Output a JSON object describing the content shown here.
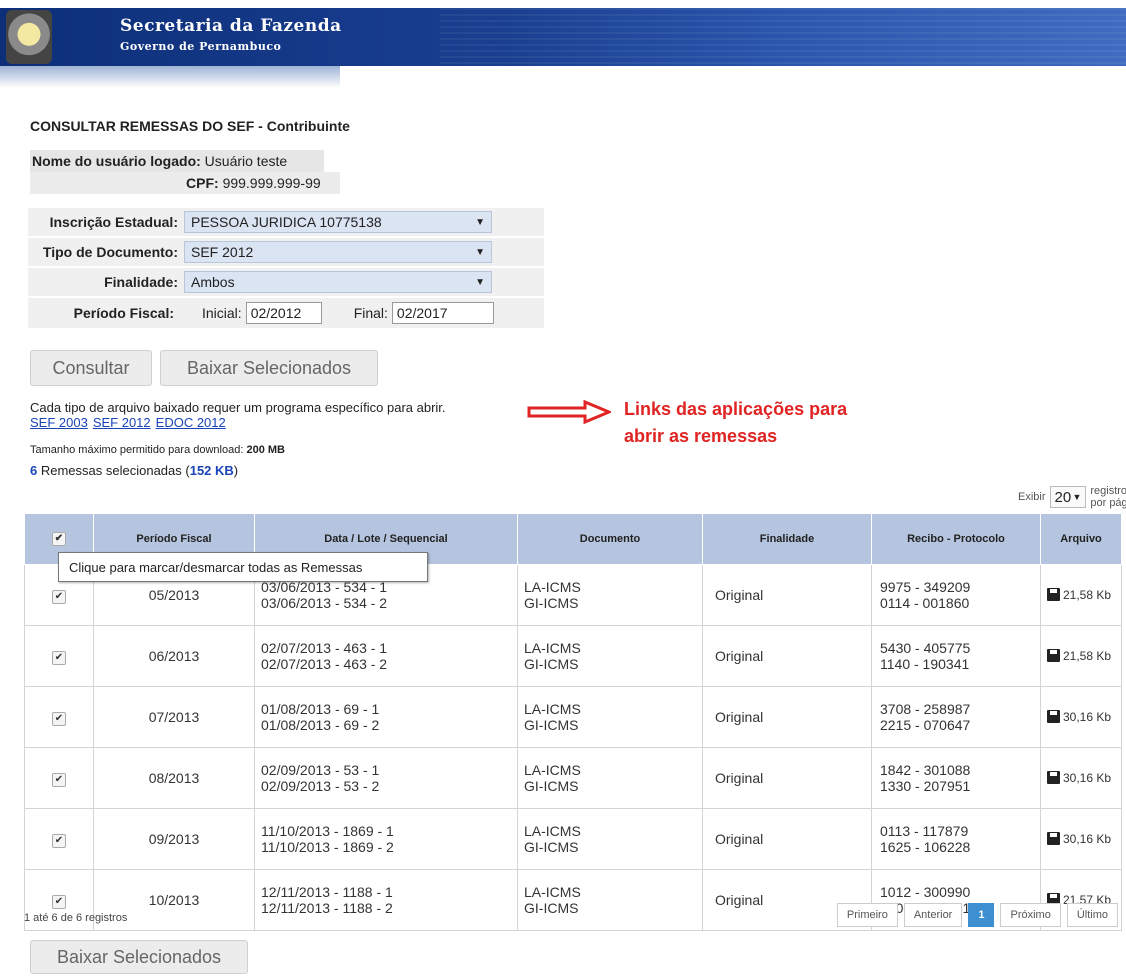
{
  "header": {
    "title": "Secretaria da Fazenda",
    "subtitle": "Governo de Pernambuco"
  },
  "page_title": "CONSULTAR REMESSAS DO SEF - Contribuinte",
  "user": {
    "name_label": "Nome do usuário logado:",
    "name_value": "Usuário teste",
    "cpf_label": "CPF:",
    "cpf_value": "999.999.999-99"
  },
  "filters": {
    "inscricao_label": "Inscrição Estadual:",
    "inscricao_value": "PESSOA JURIDICA 10775138",
    "tipo_label": "Tipo de Documento:",
    "tipo_value": "SEF 2012",
    "finalidade_label": "Finalidade:",
    "finalidade_value": "Ambos",
    "periodo_label": "Período Fiscal:",
    "inicial_label": "Inicial:",
    "inicial_value": "02/2012",
    "final_label": "Final:",
    "final_value": "02/2017"
  },
  "buttons": {
    "consultar": "Consultar",
    "baixar": "Baixar Selecionados"
  },
  "info": {
    "programs_note": "Cada tipo de arquivo baixado requer um programa específico para abrir.",
    "links": [
      "SEF 2003",
      "SEF 2012",
      "EDOC 2012"
    ],
    "max_label": "Tamanho máximo permitido para download:",
    "max_value": "200 MB",
    "selected_count": "6",
    "selected_text": "Remessas selecionadas (",
    "selected_size": "152 KB",
    "selected_close": ")"
  },
  "annotation": {
    "line1": "Links das aplicações para",
    "line2": "abrir as remessas"
  },
  "page_size": {
    "prefix": "Exibir",
    "value": "20",
    "suffix": "registros por página"
  },
  "table": {
    "headers": [
      "Período Fiscal",
      "Data / Lote / Sequencial",
      "Documento",
      "Finalidade",
      "Recibo - Protocolo",
      "Arquivo"
    ],
    "rows": [
      {
        "periodo": "05/2013",
        "data1": "03/06/2013 - 534 - 1",
        "data2": "03/06/2013 - 534 - 2",
        "doc1": "LA-ICMS",
        "doc2": "GI-ICMS",
        "finalidade": "Original",
        "rec1": "9975 - 349209",
        "rec2": "0114 - 001860",
        "arquivo": "21,58 Kb"
      },
      {
        "periodo": "06/2013",
        "data1": "02/07/2013 - 463 - 1",
        "data2": "02/07/2013 - 463 - 2",
        "doc1": "LA-ICMS",
        "doc2": "GI-ICMS",
        "finalidade": "Original",
        "rec1": "5430 - 405775",
        "rec2": "1140 - 190341",
        "arquivo": "21,58 Kb"
      },
      {
        "periodo": "07/2013",
        "data1": "01/08/2013 - 69 - 1",
        "data2": "01/08/2013 - 69 - 2",
        "doc1": "LA-ICMS",
        "doc2": "GI-ICMS",
        "finalidade": "Original",
        "rec1": "3708 - 258987",
        "rec2": "2215 - 070647",
        "arquivo": "30,16 Kb"
      },
      {
        "periodo": "08/2013",
        "data1": "02/09/2013 - 53 - 1",
        "data2": "02/09/2013 - 53 - 2",
        "doc1": "LA-ICMS",
        "doc2": "GI-ICMS",
        "finalidade": "Original",
        "rec1": "1842 - 301088",
        "rec2": "1330 - 207951",
        "arquivo": "30,16 Kb"
      },
      {
        "periodo": "09/2013",
        "data1": "11/10/2013 - 1869 - 1",
        "data2": "11/10/2013 - 1869 - 2",
        "doc1": "LA-ICMS",
        "doc2": "GI-ICMS",
        "finalidade": "Original",
        "rec1": "0113 - 117879",
        "rec2": "1625 - 106228",
        "arquivo": "30,16 Kb"
      },
      {
        "periodo": "10/2013",
        "data1": "12/11/2013 - 1188 - 1",
        "data2": "12/11/2013 - 1188 - 2",
        "doc1": "LA-ICMS",
        "doc2": "GI-ICMS",
        "finalidade": "Original",
        "rec1": "1012 - 300990",
        "rec2": "3000 - 296781",
        "arquivo": "21,57 Kb"
      }
    ]
  },
  "tooltip": "Clique para marcar/desmarcar todas as Remessas",
  "footer": {
    "records": "1 até 6 de 6 registros",
    "pager": {
      "first": "Primeiro",
      "prev": "Anterior",
      "current": "1",
      "next": "Próximo",
      "last": "Último"
    }
  },
  "colors": {
    "header_bg": "#0d2f7a",
    "table_header": "#b5c4df",
    "link": "#1a44b8",
    "annotation": "#e02323",
    "pager_active": "#3c8fd0"
  }
}
